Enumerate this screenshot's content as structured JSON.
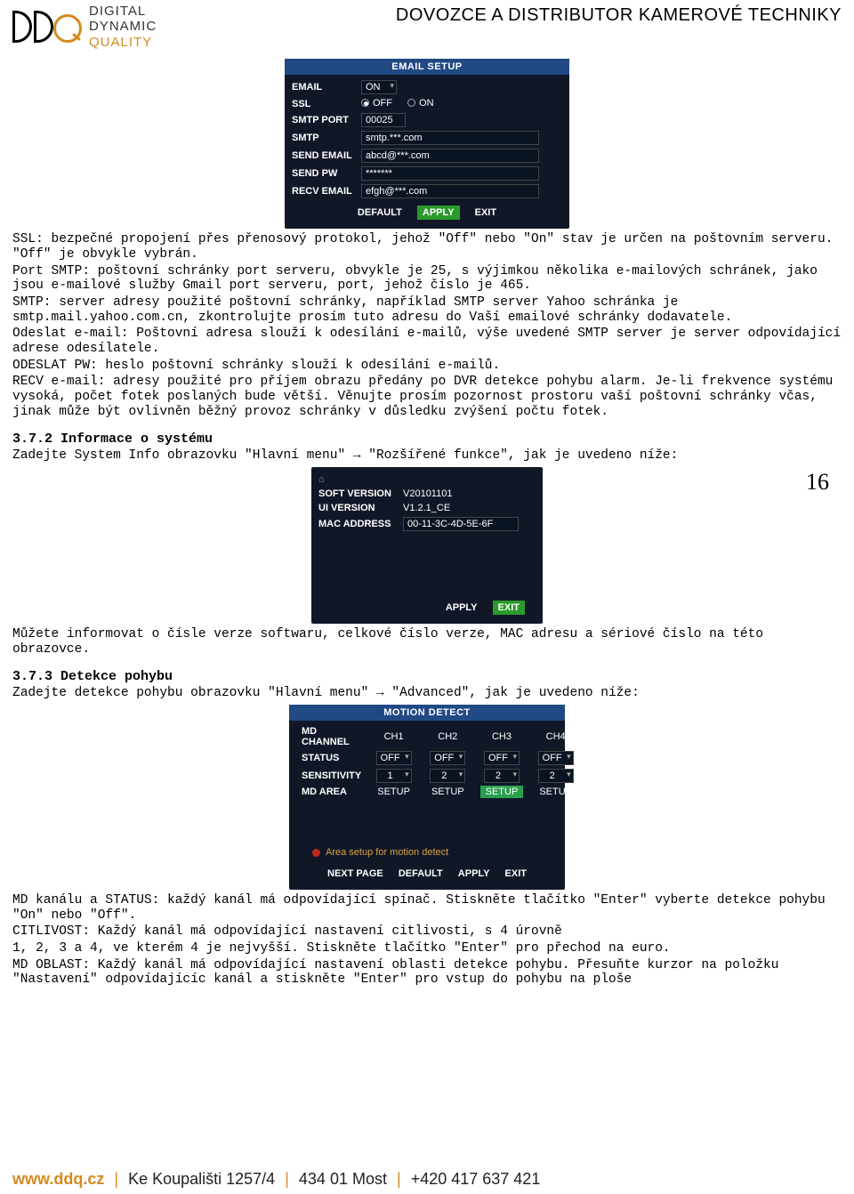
{
  "header": {
    "logo_line1": "DIGITAL",
    "logo_line2": "DYNAMIC",
    "logo_line3": "QUALITY",
    "right": "DOVOZCE A DISTRIBUTOR KAMEROVÉ TECHNIKY"
  },
  "email_setup": {
    "title": "EMAIL SETUP",
    "labels": {
      "email": "EMAIL",
      "ssl": "SSL",
      "smtp_port": "SMTP PORT",
      "smtp": "SMTP",
      "send_email": "SEND EMAIL",
      "send_pw": "SEND PW",
      "recv_email": "RECV EMAIL"
    },
    "values": {
      "email_state": "ON",
      "ssl_off": "OFF",
      "ssl_on": "ON",
      "smtp_port": "00025",
      "smtp": "smtp.***.com",
      "send_email": "abcd@***.com",
      "send_pw": "*******",
      "recv_email": "efgh@***.com"
    },
    "buttons": {
      "default": "DEFAULT",
      "apply": "APPLY",
      "exit": "EXIT"
    }
  },
  "paragraphs": {
    "p1": "SSL: bezpečné propojení přes přenosový protokol, jehož \"Off\" nebo \"On\" stav je určen na poštovním serveru. \"Off\" je obvykle vybrán.",
    "p2": "Port SMTP: poštovní schránky port serveru, obvykle je 25, s výjimkou několika e-mailových schránek, jako jsou e-mailové služby Gmail port serveru, port, jehož číslo je 465.",
    "p3": "SMTP: server adresy použité poštovní schránky, například SMTP server Yahoo schránka je smtp.mail.yahoo.com.cn, zkontrolujte prosím tuto adresu do Vaší emailové schránky dodavatele.",
    "p4": "Odeslat e-mail: Poštovní adresa slouží k odesílání e-mailů, výše uvedené SMTP server je server odpovídající adrese odesílatele.",
    "p5": "ODESLAT PW: heslo poštovní schránky slouží k odesílání e-mailů.",
    "p6": "RECV e-mail: adresy použité pro příjem obrazu předány po DVR detekce pohybu alarm. Je-li frekvence systému vysoká, počet fotek poslaných bude větší. Věnujte prosím pozornost prostoru vaší poštovní schránky včas, jinak může být ovlivněn běžný provoz schránky v důsledku zvýšení počtu fotek."
  },
  "section_372": {
    "head": "3.7.2 Informace o systému",
    "intro": "Zadejte System Info obrazovku \"Hlavní menu\" → \"Rozšířené funkce\", jak je uvedeno níže:"
  },
  "page_number": "16",
  "sysinfo": {
    "labels": {
      "soft": "SOFT VERSION",
      "ui": "UI VERSION",
      "mac": "MAC ADDRESS"
    },
    "values": {
      "soft": "V20101101",
      "ui": "V1.2.1_CE",
      "mac": "00-11-3C-4D-5E-6F"
    },
    "buttons": {
      "apply": "APPLY",
      "exit": "EXIT"
    }
  },
  "after_sysinfo": "Můžete informovat o čísle verze softwaru, celkové číslo verze, MAC adresu a sériové číslo na této obrazovce.",
  "section_373": {
    "head": "3.7.3 Detekce pohybu",
    "intro": " Zadejte detekce pohybu obrazovku \"Hlavní menu\" → \"Advanced\", jak je uvedeno níže:"
  },
  "motion": {
    "title": "MOTION DETECT",
    "labels": {
      "md_channel": "MD CHANNEL",
      "status": "STATUS",
      "sensitivity": "SENSITIVITY",
      "md_area": "MD AREA"
    },
    "channels": [
      "CH1",
      "CH2",
      "CH3",
      "CH4"
    ],
    "status": [
      "OFF",
      "OFF",
      "OFF",
      "OFF"
    ],
    "sensitivity": [
      "1",
      "2",
      "2",
      "2"
    ],
    "area": [
      "SETUP",
      "SETUP",
      "SETUP",
      "SETUP"
    ],
    "note": "Area setup for motion detect",
    "buttons": {
      "next": "NEXT PAGE",
      "default": "DEFAULT",
      "apply": "APPLY",
      "exit": "EXIT"
    }
  },
  "after_motion": {
    "p1": "MD kanálu a STATUS: každý kanál má odpovídající spínač. Stiskněte tlačítko \"Enter\" vyberte detekce pohybu \"On\" nebo \"Off\".",
    "p2": "CITLIVOST: Každý kanál má odpovídající nastavení citlivosti, s 4 úrovně",
    "p3": "1, 2, 3 a 4, ve kterém 4 je nejvyšší. Stiskněte tlačítko \"Enter\" pro přechod na euro.",
    "p4": "MD OBLAST: Každý kanál má odpovídající nastavení oblasti detekce pohybu. Přesuňte kurzor na položku \"Nastavení\" odpovídajícíc kanál a stiskněte \"Enter\" pro vstup do pohybu na ploše"
  },
  "footer": {
    "www": "www.ddq.cz",
    "addr": "Ke Koupališti 1257/4",
    "zip": "434 01 Most",
    "tel": "+420 417 637 421"
  }
}
